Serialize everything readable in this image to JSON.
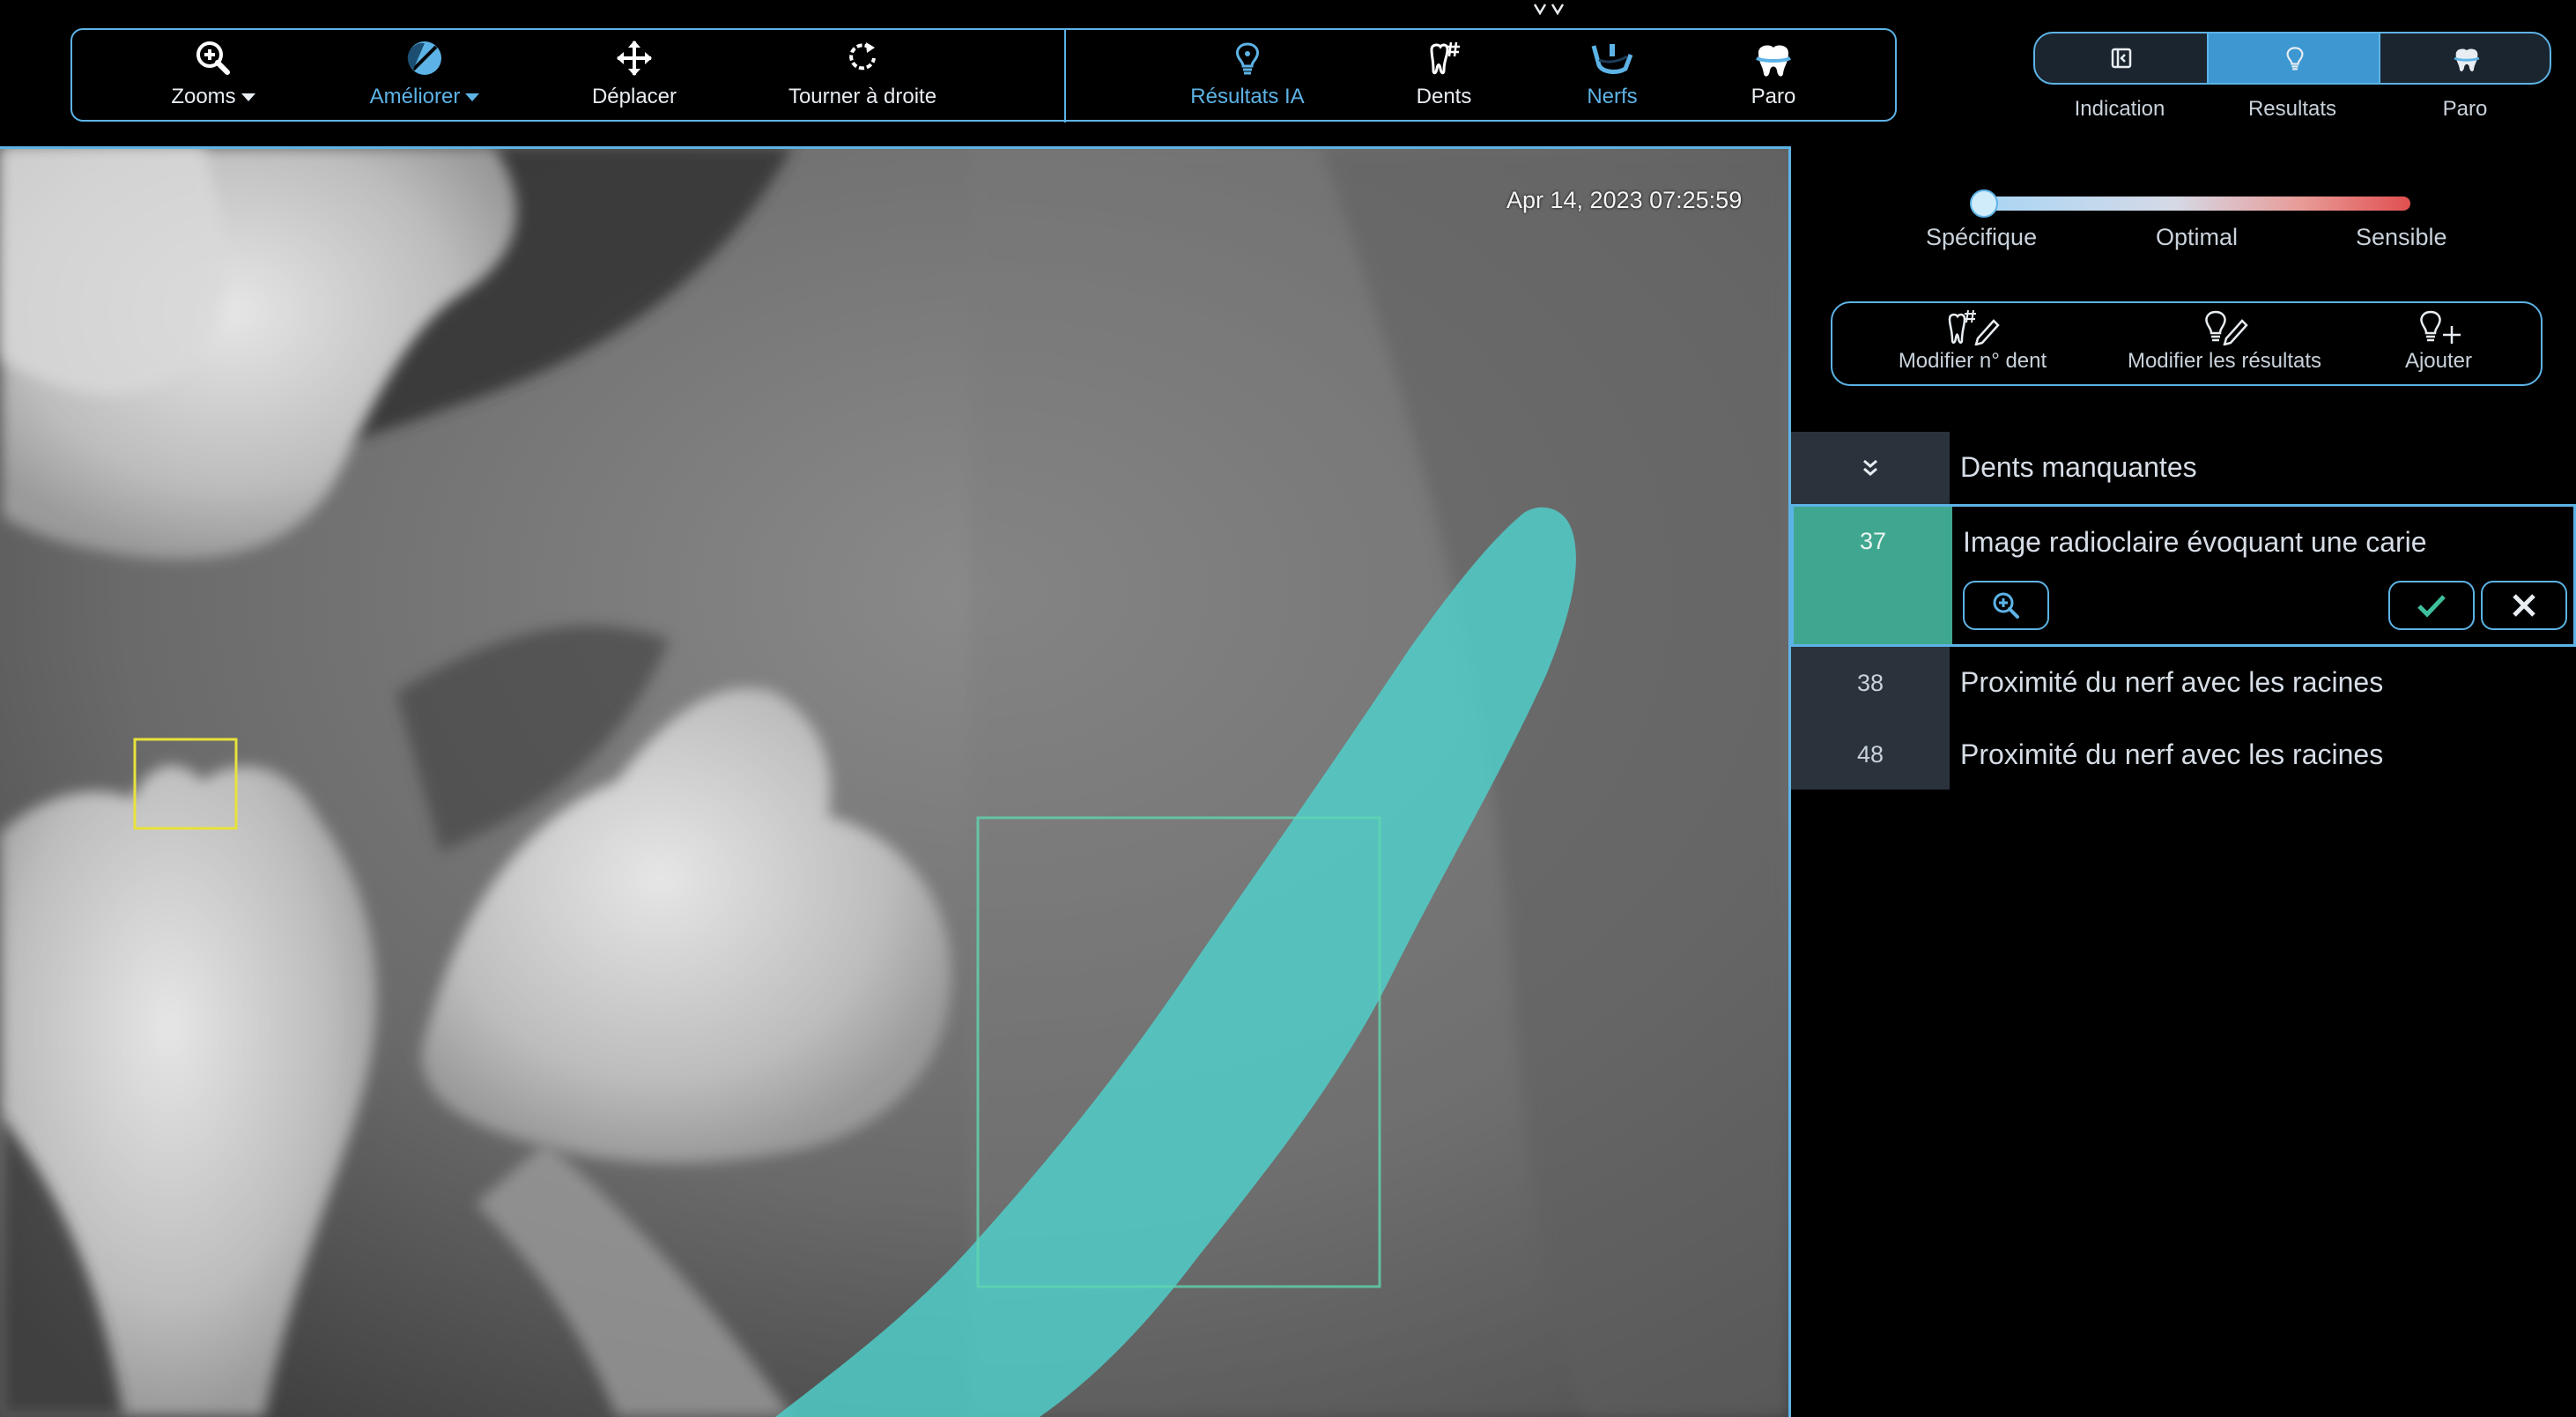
{
  "toolbar": {
    "left_tools": [
      {
        "label": "Zooms",
        "icon": "zoom-in-icon",
        "has_dropdown": true
      },
      {
        "label": "Améliorer",
        "icon": "contrast-icon",
        "has_dropdown": true
      },
      {
        "label": "Déplacer",
        "icon": "move-icon"
      },
      {
        "label": "Tourner à droite",
        "icon": "rotate-right-icon"
      }
    ],
    "right_tools": [
      {
        "label": "Résultats IA",
        "icon": "ai-results-icon"
      },
      {
        "label": "Dents",
        "icon": "tooth-number-icon"
      },
      {
        "label": "Nerfs",
        "icon": "jaw-nerve-icon"
      },
      {
        "label": "Paro",
        "icon": "perio-icon"
      }
    ]
  },
  "view_switch": {
    "items": [
      {
        "label": "Indication",
        "icon": "collapse-panel-icon"
      },
      {
        "label": "Resultats",
        "icon": "ai-results-icon",
        "active": true
      },
      {
        "label": "Paro",
        "icon": "perio-icon"
      }
    ]
  },
  "viewer": {
    "timestamp": "Apr 14, 2023 07:25:59"
  },
  "sensitivity": {
    "labels": [
      "Spécifique",
      "Optimal",
      "Sensible"
    ],
    "value": 0.0
  },
  "actions": [
    {
      "label": "Modifier n° dent",
      "icon": "tooth-edit-number-icon"
    },
    {
      "label": "Modifier les résultats",
      "icon": "edit-results-icon"
    },
    {
      "label": "Ajouter",
      "icon": "add-result-icon"
    }
  ],
  "results": {
    "header_label": "Dents manquantes",
    "items": [
      {
        "tooth": "37",
        "label": "Image radioclaire évoquant une carie",
        "selected": true
      },
      {
        "tooth": "38",
        "label": "Proximité du nerf avec les racines"
      },
      {
        "tooth": "48",
        "label": "Proximité du nerf avec les racines"
      }
    ]
  },
  "colors": {
    "accent": "#5db3e6",
    "selected_row": "#3fa78f",
    "nerve_overlay": "#4fd1cc",
    "caries_box": "#e8e23a"
  }
}
